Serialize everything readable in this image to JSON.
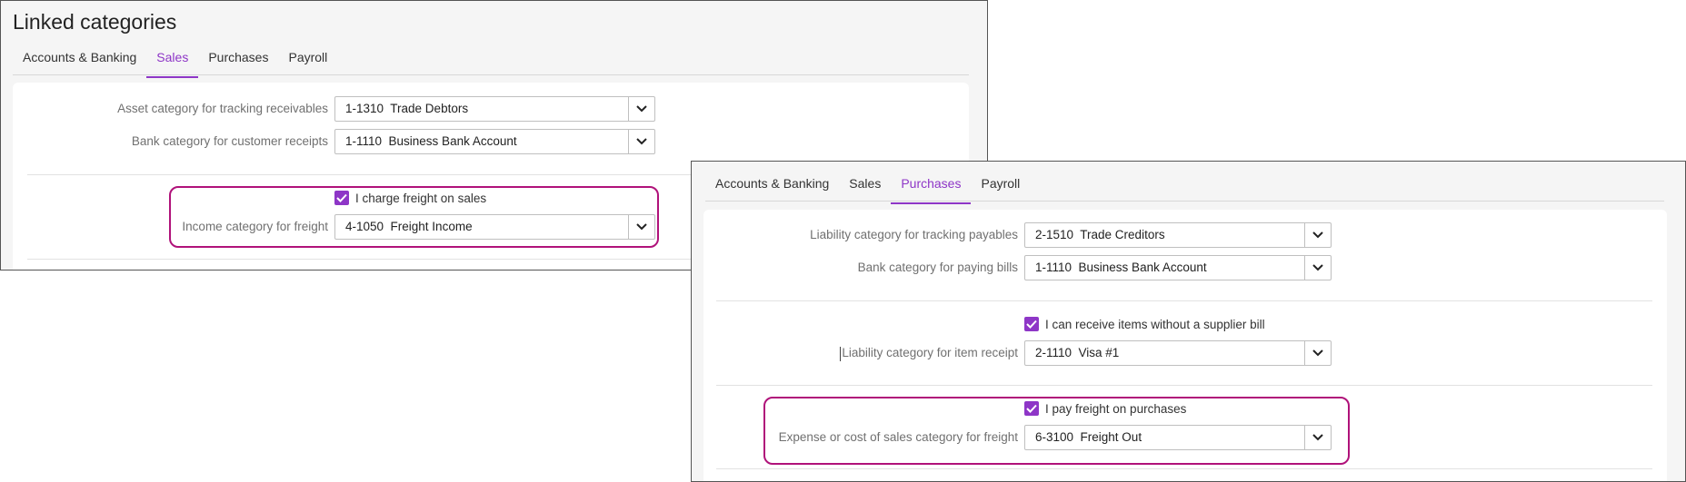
{
  "sales_panel": {
    "title": "Linked categories",
    "tabs": [
      {
        "label": "Accounts & Banking",
        "active": false
      },
      {
        "label": "Sales",
        "active": true
      },
      {
        "label": "Purchases",
        "active": false
      },
      {
        "label": "Payroll",
        "active": false
      }
    ],
    "fields": [
      {
        "label": "Asset category for tracking receivables",
        "value": "1-1310  Trade Debtors"
      },
      {
        "label": "Bank category for customer receipts",
        "value": "1-1110  Business Bank Account"
      }
    ],
    "freight_checkbox": {
      "label": "I charge freight on sales",
      "checked": true
    },
    "freight_field": {
      "label": "Income category for freight",
      "value": "4-1050  Freight Income"
    }
  },
  "purchases_panel": {
    "tabs": [
      {
        "label": "Accounts & Banking",
        "active": false
      },
      {
        "label": "Sales",
        "active": false
      },
      {
        "label": "Purchases",
        "active": true
      },
      {
        "label": "Payroll",
        "active": false
      }
    ],
    "fields": [
      {
        "label": "Liability category for tracking payables",
        "value": "2-1510  Trade Creditors"
      },
      {
        "label": "Bank category for paying bills",
        "value": "1-1110  Business Bank Account"
      }
    ],
    "receipt_checkbox": {
      "label": "I can receive items without a supplier bill",
      "checked": true
    },
    "receipt_field": {
      "label": "Liability category for item receipt",
      "value": "2-1110  Visa #1"
    },
    "freight_checkbox": {
      "label": "I pay freight on purchases",
      "checked": true
    },
    "freight_field": {
      "label": "Expense or cost of sales category for freight",
      "value": "6-3100  Freight Out"
    }
  },
  "colors": {
    "accent": "#8e36c7",
    "highlight": "#b0127a"
  },
  "icons": {
    "dropdown": "chevron-down-icon",
    "check": "checkmark-icon"
  }
}
